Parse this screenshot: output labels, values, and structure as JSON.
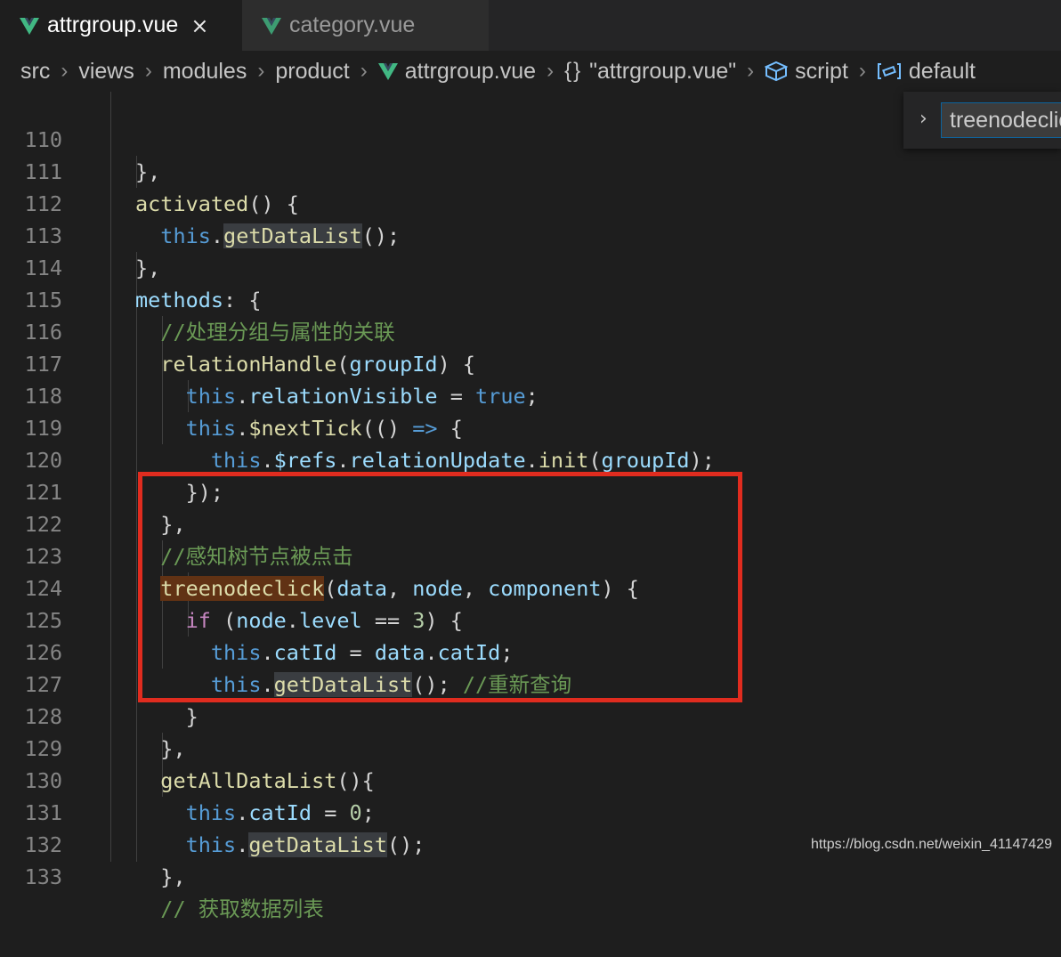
{
  "tabs": [
    {
      "label": "attrgroup.vue",
      "active": true,
      "close": "×"
    },
    {
      "label": "category.vue",
      "active": false
    }
  ],
  "breadcrumb": {
    "src": "src",
    "views": "views",
    "modules": "modules",
    "product": "product",
    "file": "attrgroup.vue",
    "braces": "{}",
    "component": "\"attrgroup.vue\"",
    "script": "script",
    "default": "default"
  },
  "find": {
    "value": "treenodeclick"
  },
  "lines": [
    {
      "n": "110"
    },
    {
      "n": "111"
    },
    {
      "n": "112"
    },
    {
      "n": "113"
    },
    {
      "n": "114"
    },
    {
      "n": "115"
    },
    {
      "n": "116"
    },
    {
      "n": "117"
    },
    {
      "n": "118"
    },
    {
      "n": "119"
    },
    {
      "n": "120"
    },
    {
      "n": "121"
    },
    {
      "n": "122"
    },
    {
      "n": "123"
    },
    {
      "n": "124"
    },
    {
      "n": "125"
    },
    {
      "n": "126"
    },
    {
      "n": "127"
    },
    {
      "n": "128"
    },
    {
      "n": "129"
    },
    {
      "n": "130"
    },
    {
      "n": "131"
    },
    {
      "n": "132"
    },
    {
      "n": "133"
    }
  ],
  "code": {
    "l110": "},",
    "l111_fn": "activated",
    "l111_rest": "() {",
    "l112_this": "this",
    "l112_dot": ".",
    "l112_fn": "getDataList",
    "l112_rest": "();",
    "l113": "},",
    "l114_key": "methods",
    "l114_rest": ": {",
    "l115": "//处理分组与属性的关联",
    "l116_fn": "relationHandle",
    "l116_p1": "(",
    "l116_arg": "groupId",
    "l116_rest": ") {",
    "l117_this": "this",
    "l117_dot": ".",
    "l117_prop": "relationVisible",
    "l117_eq": " = ",
    "l117_val": "true",
    "l117_end": ";",
    "l118_this": "this",
    "l118_dot": ".",
    "l118_fn": "$nextTick",
    "l118_p": "(() ",
    "l118_arrow": "=>",
    "l118_rest": " {",
    "l119_this": "this",
    "l119_dot1": ".",
    "l119_refs": "$refs",
    "l119_dot2": ".",
    "l119_ru": "relationUpdate",
    "l119_dot3": ".",
    "l119_init": "init",
    "l119_p1": "(",
    "l119_arg": "groupId",
    "l119_rest": ");",
    "l120": "});",
    "l121": "},",
    "l122": "//感知树节点被点击",
    "l123_fn": "treenodeclick",
    "l123_p1": "(",
    "l123_a1": "data",
    "l123_c1": ", ",
    "l123_a2": "node",
    "l123_c2": ", ",
    "l123_a3": "component",
    "l123_rest": ") {",
    "l124_if": "if",
    "l124_p1": " (",
    "l124_node": "node",
    "l124_dot": ".",
    "l124_level": "level",
    "l124_eq": " == ",
    "l124_num": "3",
    "l124_rest": ") {",
    "l125_this": "this",
    "l125_dot": ".",
    "l125_prop": "catId",
    "l125_eq": " = ",
    "l125_data": "data",
    "l125_dot2": ".",
    "l125_cat": "catId",
    "l125_end": ";",
    "l126_this": "this",
    "l126_dot": ".",
    "l126_fn": "getDataList",
    "l126_rest": "(); ",
    "l126_cm": "//重新查询",
    "l127": "}",
    "l128": "},",
    "l129_fn": "getAllDataList",
    "l129_rest": "(){",
    "l130_this": "this",
    "l130_dot": ".",
    "l130_prop": "catId",
    "l130_eq": " = ",
    "l130_num": "0",
    "l130_end": ";",
    "l131_this": "this",
    "l131_dot": ".",
    "l131_fn": "getDataList",
    "l131_rest": "();",
    "l132": "},",
    "l133": "// 获取数据列表"
  },
  "watermark": "https://blog.csdn.net/weixin_41147429",
  "colors": {
    "vue_green": "#41b883",
    "highlight_box": "#e02c1f"
  }
}
